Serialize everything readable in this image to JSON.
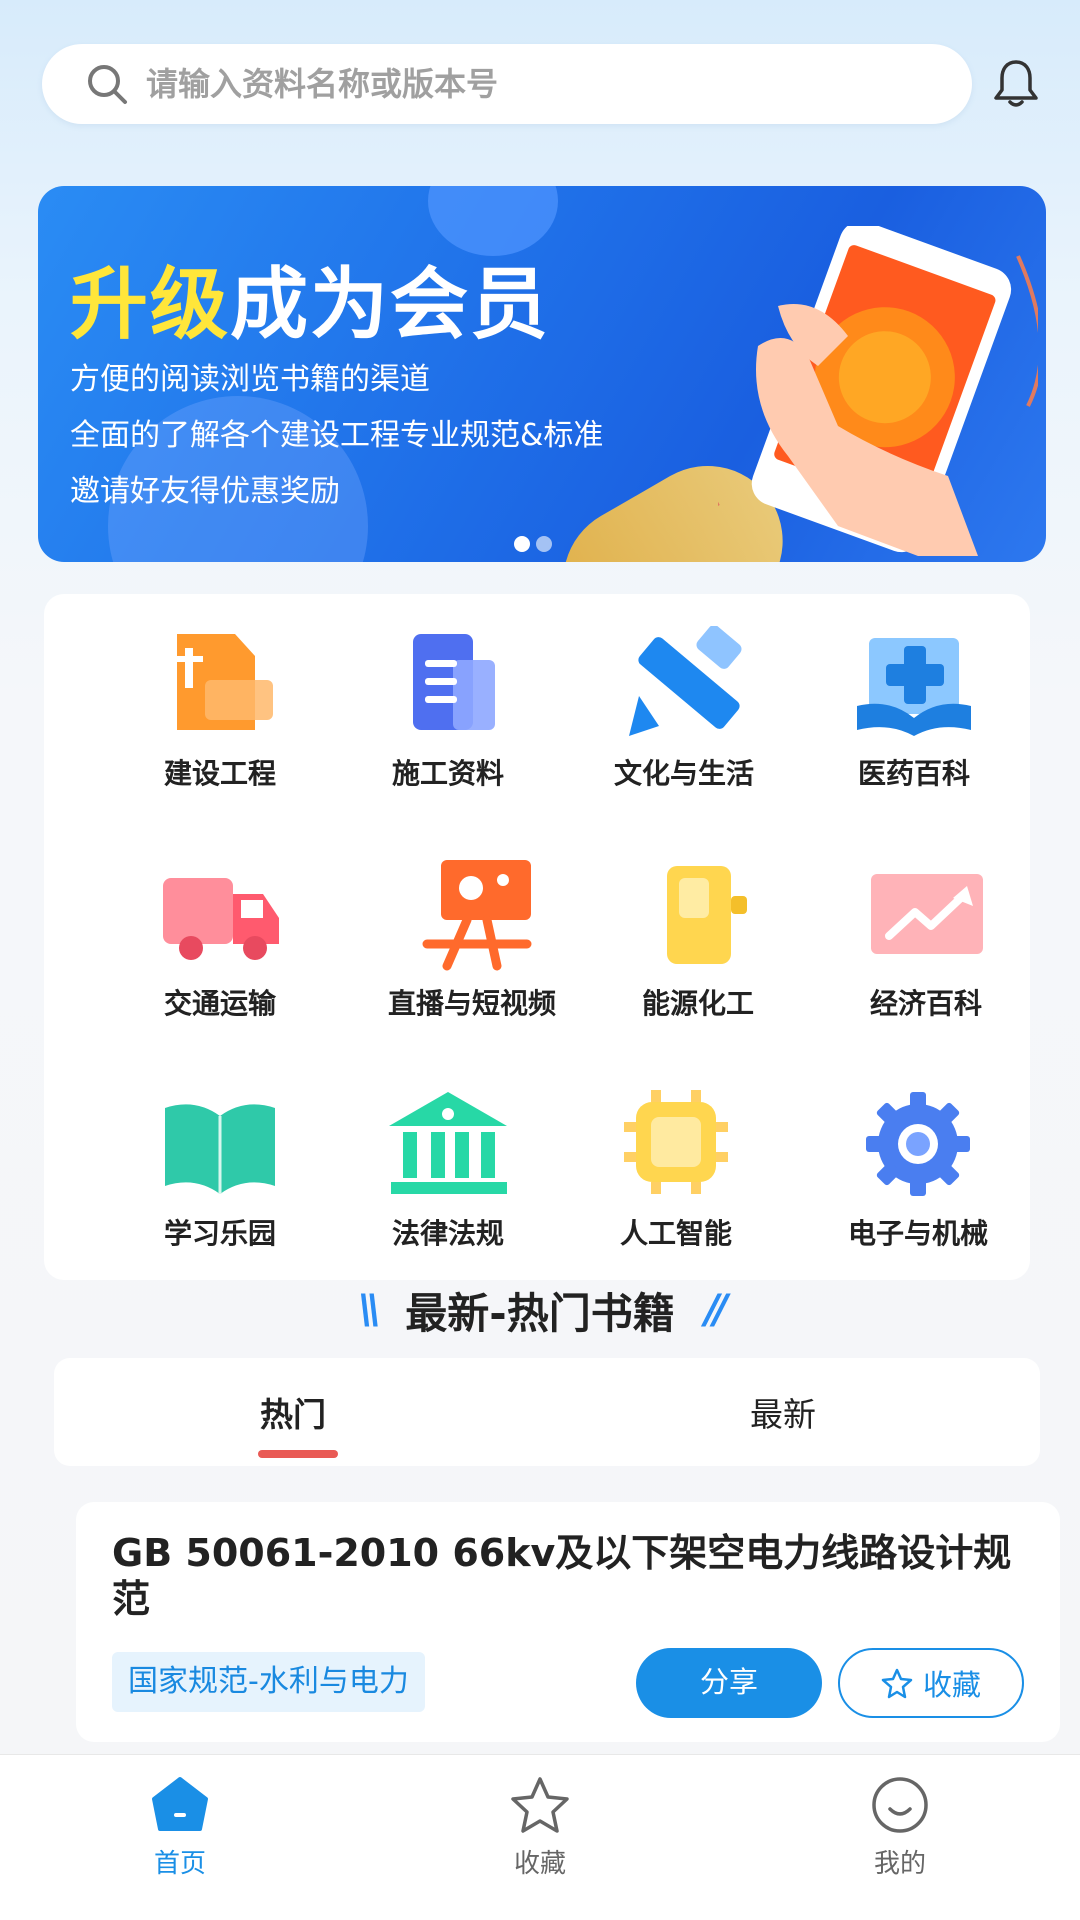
{
  "search": {
    "placeholder": "请输入资料名称或版本号"
  },
  "banner": {
    "title_highlight": "升级",
    "title_rest": "成为会员",
    "lines": [
      "方便的阅读浏览书籍的渠道",
      "全面的了解各个建设工程专业规范&标准",
      "邀请好友得优惠奖励"
    ],
    "page_count": 2,
    "active_page": 1
  },
  "categories": [
    {
      "label": "建设工程",
      "icon": "construction-doc-icon"
    },
    {
      "label": "施工资料",
      "icon": "building-docs-icon"
    },
    {
      "label": "文化与生活",
      "icon": "ruler-pencil-icon"
    },
    {
      "label": "医药百科",
      "icon": "medical-book-icon"
    },
    {
      "label": "交通运输",
      "icon": "truck-icon"
    },
    {
      "label": "直播与短视频",
      "icon": "camera-tripod-icon"
    },
    {
      "label": "能源化工",
      "icon": "fuel-tank-icon"
    },
    {
      "label": "经济百科",
      "icon": "trend-chart-icon"
    },
    {
      "label": "学习乐园",
      "icon": "open-book-icon"
    },
    {
      "label": "法律法规",
      "icon": "courthouse-icon"
    },
    {
      "label": "人工智能",
      "icon": "chip-icon"
    },
    {
      "label": "电子与机械",
      "icon": "gear-icon"
    }
  ],
  "section": {
    "title": "最新-热门书籍"
  },
  "tabs": [
    {
      "label": "热门",
      "active": true
    },
    {
      "label": "最新",
      "active": false
    }
  ],
  "book": {
    "title": "GB 50061-2010 66kv及以下架空电力线路设计规范",
    "tag": "国家规范-水利与电力",
    "share_label": "分享",
    "favorite_label": "收藏"
  },
  "bottom_nav": [
    {
      "label": "首页",
      "icon": "home-icon",
      "active": true
    },
    {
      "label": "收藏",
      "icon": "star-icon",
      "active": false
    },
    {
      "label": "我的",
      "icon": "smiley-icon",
      "active": false
    }
  ],
  "colors": {
    "accent": "#1a8fe6",
    "tab_indicator": "#e95a55",
    "banner_highlight": "#ffe63a"
  }
}
